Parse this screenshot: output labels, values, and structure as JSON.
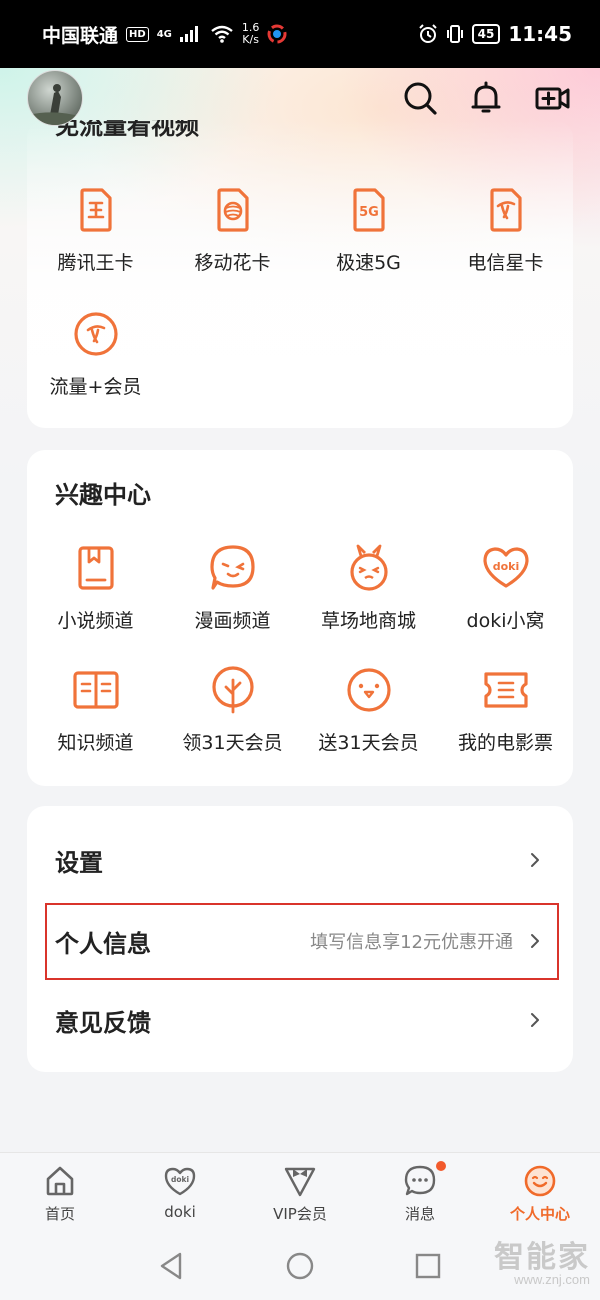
{
  "status_bar": {
    "carrier": "中国联通",
    "hd": "HD",
    "network": "4G",
    "speed_value": "1.6",
    "speed_unit": "K/s",
    "battery": "45",
    "time": "11:45"
  },
  "header": {
    "icons": [
      "search-icon",
      "bell-icon",
      "video-camera-plus-icon"
    ]
  },
  "free_flow": {
    "title": "免流量看视频",
    "items": [
      {
        "label": "腾讯王卡",
        "icon": "wang-card-icon"
      },
      {
        "label": "移动花卡",
        "icon": "mobile-card-icon"
      },
      {
        "label": "极速5G",
        "icon": "5g-card-icon"
      },
      {
        "label": "电信星卡",
        "icon": "telecom-card-icon"
      },
      {
        "label": "流量+会员",
        "icon": "telecom-circle-icon"
      }
    ]
  },
  "interest": {
    "title": "兴趣中心",
    "items": [
      {
        "label": "小说频道",
        "icon": "novel-icon"
      },
      {
        "label": "漫画频道",
        "icon": "comic-icon"
      },
      {
        "label": "草场地商城",
        "icon": "rabbit-mall-icon"
      },
      {
        "label": "doki小窝",
        "icon": "doki-heart-icon",
        "badge_text": "doki"
      },
      {
        "label": "知识频道",
        "icon": "book-open-icon"
      },
      {
        "label": "领31天会员",
        "icon": "tree-icon"
      },
      {
        "label": "送31天会员",
        "icon": "face-gift-icon"
      },
      {
        "label": "我的电影票",
        "icon": "ticket-icon"
      }
    ]
  },
  "menu": [
    {
      "label": "设置",
      "hint": ""
    },
    {
      "label": "个人信息",
      "hint": "填写信息享12元优惠开通"
    },
    {
      "label": "意见反馈",
      "hint": ""
    }
  ],
  "tabs": [
    {
      "label": "首页",
      "icon": "home-icon",
      "active": false
    },
    {
      "label": "doki",
      "icon": "doki-tab-icon",
      "active": false
    },
    {
      "label": "VIP会员",
      "icon": "vip-bowtie-icon",
      "active": false
    },
    {
      "label": "消息",
      "icon": "message-icon",
      "active": false,
      "has_badge": true
    },
    {
      "label": "个人中心",
      "icon": "smiley-icon",
      "active": true
    }
  ],
  "colors": {
    "accent": "#f06a2a",
    "icon_orange": "#f0733a",
    "highlight": "#d9342b"
  },
  "watermark": {
    "cn": "智能家",
    "url": "www.znj.com"
  }
}
